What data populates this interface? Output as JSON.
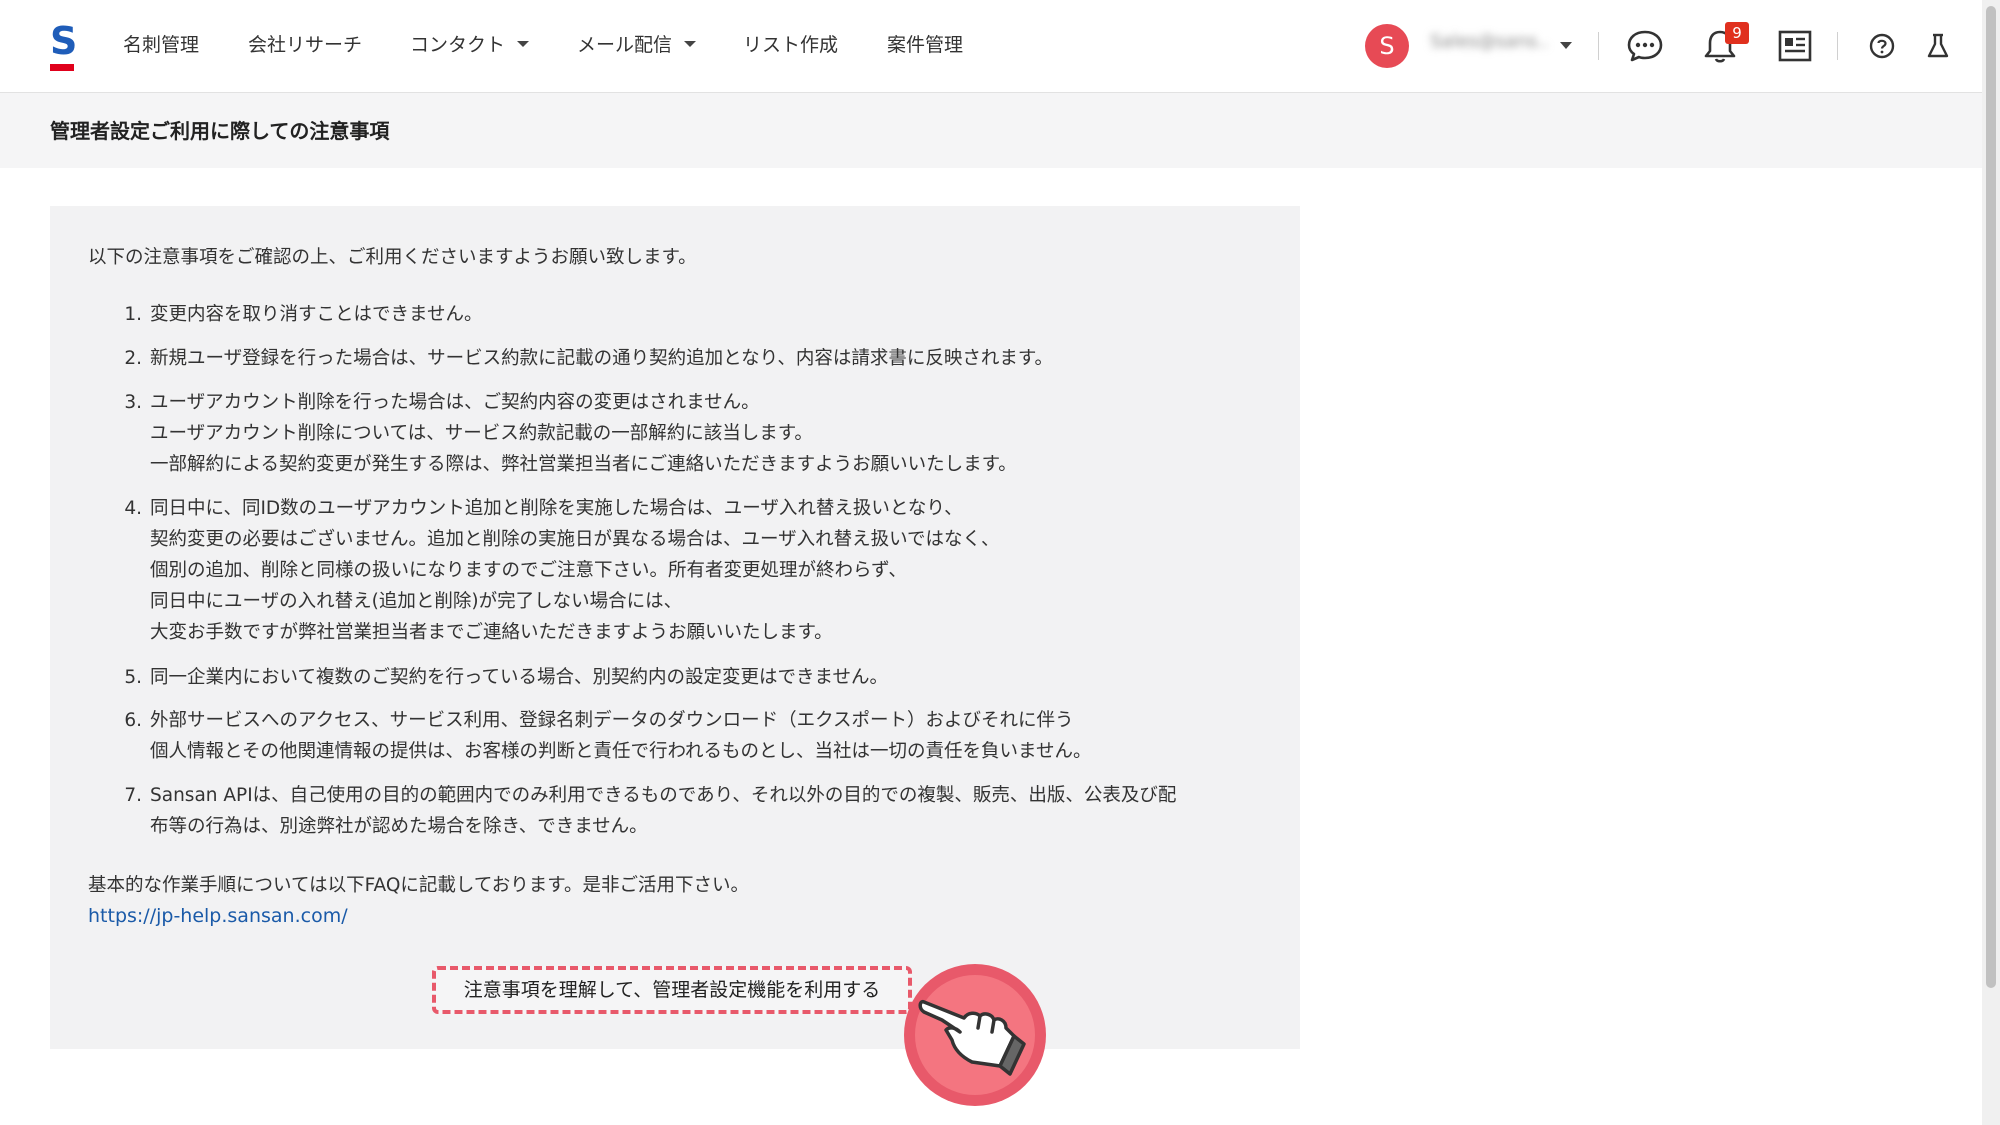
{
  "header": {
    "logo_letter": "S",
    "nav": [
      {
        "label": "名刺管理",
        "has_caret": false
      },
      {
        "label": "会社リサーチ",
        "has_caret": false
      },
      {
        "label": "コンタクト",
        "has_caret": true
      },
      {
        "label": "メール配信",
        "has_caret": true
      },
      {
        "label": "リスト作成",
        "has_caret": false
      },
      {
        "label": "案件管理",
        "has_caret": false
      }
    ],
    "avatar_initial": "S",
    "username_blurred": "Sales@sans...",
    "notification_count": "9",
    "icons": [
      "chat-icon",
      "bell-icon",
      "news-icon",
      "help-icon",
      "lab-flask-icon"
    ]
  },
  "page": {
    "title": "管理者設定ご利用に際しての注意事項",
    "intro": "以下の注意事項をご確認の上、ご利用くださいますようお願い致します。",
    "items": [
      {
        "num": "1.",
        "lines": [
          "変更内容を取り消すことはできません。"
        ]
      },
      {
        "num": "2.",
        "lines": [
          "新規ユーザ登録を行った場合は、サービス約款に記載の通り契約追加となり、内容は請求書に反映されます。"
        ]
      },
      {
        "num": "3.",
        "lines": [
          "ユーザアカウント削除を行った場合は、ご契約内容の変更はされません。",
          "ユーザアカウント削除については、サービス約款記載の一部解約に該当します。",
          "一部解約による契約変更が発生する際は、弊社営業担当者にご連絡いただきますようお願いいたします。"
        ]
      },
      {
        "num": "4.",
        "lines": [
          "同日中に、同ID数のユーザアカウント追加と削除を実施した場合は、ユーザ入れ替え扱いとなり、",
          "契約変更の必要はございません。追加と削除の実施日が異なる場合は、ユーザ入れ替え扱いではなく、",
          "個別の追加、削除と同様の扱いになりますのでご注意下さい。所有者変更処理が終わらず、",
          "同日中にユーザの入れ替え(追加と削除)が完了しない場合には、",
          "大変お手数ですが弊社営業担当者までご連絡いただきますようお願いいたします。"
        ]
      },
      {
        "num": "5.",
        "lines": [
          "同一企業内において複数のご契約を行っている場合、別契約内の設定変更はできません。"
        ]
      },
      {
        "num": "6.",
        "lines": [
          "外部サービスへのアクセス、サービス利用、登録名刺データのダウンロード（エクスポート）およびそれに伴う",
          "個人情報とその他関連情報の提供は、お客様の判断と責任で行われるものとし、当社は一切の責任を負いません。"
        ]
      },
      {
        "num": "7.",
        "lines": [
          "Sansan APIは、自己使用の目的の範囲内でのみ利用できるものであり、それ以外の目的での複製、販売、出版、公表及び配",
          "布等の行為は、別途弊社が認めた場合を除き、できません。"
        ]
      }
    ],
    "footer_text": "基本的な作業手順については以下FAQに記載しております。是非ご活用下さい。",
    "faq_url": "https://jp-help.sansan.com/",
    "agree_button": "注意事項を理解して、管理者設定機能を利用する"
  },
  "colors": {
    "brand_blue": "#1f5db9",
    "brand_red": "#e0001b",
    "avatar": "#e74a55",
    "badge": "#e0301e",
    "link": "#1a5aa8",
    "highlight": "#e8596a"
  }
}
